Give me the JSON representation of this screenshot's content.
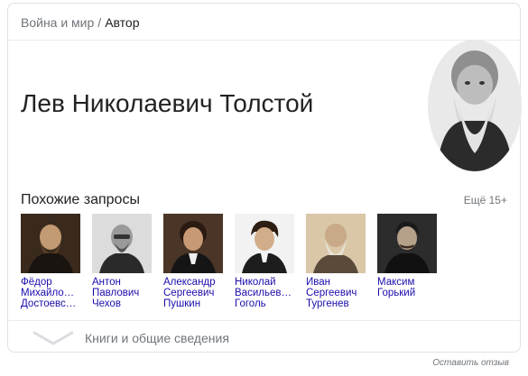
{
  "breadcrumb": {
    "parent": "Война и мир",
    "separator": "/",
    "current": "Автор"
  },
  "entity": {
    "title": "Лев Николаевич Толстой",
    "portrait_icon": "portrait-photo"
  },
  "related": {
    "header": "Похожие запросы",
    "more": "Ещё 15+",
    "people": [
      {
        "name": "Фёдор\nМихайло…\nДостоевс…"
      },
      {
        "name": "Антон\nПавлович\nЧехов"
      },
      {
        "name": "Александр\nСергеевич\nПушкин"
      },
      {
        "name": "Николай\nВасильев…\nГоголь"
      },
      {
        "name": "Иван\nСергеевич\nТургенев"
      },
      {
        "name": "Максим\nГорький"
      }
    ]
  },
  "expander": {
    "label": "Книги и общие сведения",
    "icon": "chevron-down-icon"
  },
  "feedback": "Оставить отзыв",
  "colors": {
    "link": "#1a0dab",
    "muted": "#70757a",
    "border": "#dfe1e5"
  }
}
